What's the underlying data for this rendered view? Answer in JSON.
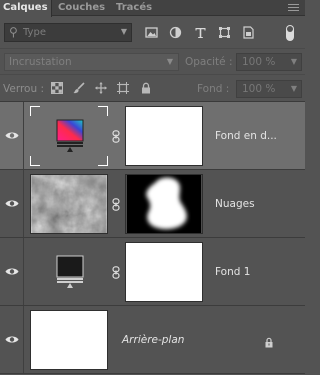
{
  "tabs": [
    {
      "label": "Calques",
      "active": true
    },
    {
      "label": "Couches",
      "active": false
    },
    {
      "label": "Tracés",
      "active": false
    }
  ],
  "filter": {
    "search_label": "Type",
    "filter_icons": [
      "image-filter-icon",
      "adjustment-filter-icon",
      "text-filter-icon",
      "shape-filter-icon",
      "smart-object-filter-icon"
    ],
    "toggle_icon": "filter-toggle-icon"
  },
  "blend": {
    "mode": "Incrustation",
    "opacity_label": "Opacité :",
    "opacity_value": "100 %"
  },
  "lock": {
    "label": "Verrou :",
    "icons": [
      "lock-transparent-pixels-icon",
      "lock-image-pixels-icon",
      "lock-position-icon",
      "lock-artboard-icon",
      "lock-all-icon"
    ],
    "fill_label": "Fond :",
    "fill_value": "100 %"
  },
  "layers": [
    {
      "name": "Fond en d...",
      "selected": true,
      "thumb": "adjustment-gradient-map",
      "mask": "white"
    },
    {
      "name": "Nuages",
      "selected": false,
      "thumb": "clouds",
      "mask": "silhouette"
    },
    {
      "name": "Fond 1",
      "selected": false,
      "thumb": "adjustment-solid-black",
      "mask": "white"
    },
    {
      "name": "Arrière-plan",
      "selected": false,
      "thumb": "white",
      "locked": true
    }
  ],
  "colors": {
    "panel_bg": "#535353",
    "selected_row": "#6f6f6f",
    "text": "#e4e4e4"
  }
}
